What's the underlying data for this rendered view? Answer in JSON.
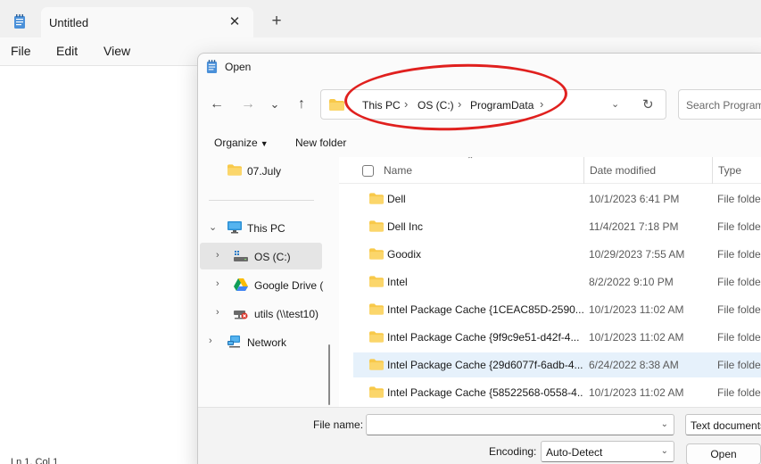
{
  "notepad": {
    "tab_title": "Untitled",
    "tab_close": "✕",
    "new_tab": "+",
    "menus": [
      "File",
      "Edit",
      "View"
    ],
    "status": "Ln 1, Col 1"
  },
  "dialog": {
    "title": "Open",
    "nav": {
      "back": "←",
      "forward": "→",
      "recent": "⌄",
      "up": "↑"
    },
    "breadcrumbs": [
      "This PC",
      "OS (C:)",
      "ProgramData"
    ],
    "crumb_sep": "›",
    "search_placeholder": "Search ProgramData",
    "commands": {
      "organize": "Organize",
      "new_folder": "New folder"
    },
    "tree": [
      {
        "label": "07.July",
        "icon": "folder-icon"
      },
      {
        "label": "This PC",
        "icon": "monitor-icon"
      },
      {
        "label": "OS (C:)",
        "icon": "drive-icon"
      },
      {
        "label": "Google Drive (",
        "icon": "google-drive-icon"
      },
      {
        "label": "utils (\\\\test10)",
        "icon": "network-drive-icon"
      },
      {
        "label": "Network",
        "icon": "network-icon"
      }
    ],
    "columns": {
      "name": "Name",
      "date": "Date modified",
      "type": "Type"
    },
    "files": [
      {
        "name": "Dell",
        "date": "10/1/2023 6:41 PM",
        "type": "File folder"
      },
      {
        "name": "Dell Inc",
        "date": "11/4/2021 7:18 PM",
        "type": "File folder"
      },
      {
        "name": "Goodix",
        "date": "10/29/2023 7:55 AM",
        "type": "File folder"
      },
      {
        "name": "Intel",
        "date": "8/2/2022 9:10 PM",
        "type": "File folder"
      },
      {
        "name": "Intel Package Cache {1CEAC85D-2590...",
        "date": "10/1/2023 11:02 AM",
        "type": "File folder"
      },
      {
        "name": "Intel Package Cache {9f9c9e51-d42f-4...",
        "date": "10/1/2023 11:02 AM",
        "type": "File folder"
      },
      {
        "name": "Intel Package Cache {29d6077f-6adb-4...",
        "date": "6/24/2022 8:38 AM",
        "type": "File folder"
      },
      {
        "name": "Intel Package Cache {58522568-0558-4...",
        "date": "10/1/2023 11:02 AM",
        "type": "File folder"
      }
    ],
    "footer": {
      "filename_label": "File name:",
      "filename_value": "",
      "filetype_value": "Text documents",
      "encoding_label": "Encoding:",
      "encoding_value": "Auto-Detect",
      "open_label": "Open"
    }
  },
  "colors": {
    "folder": "#f8c94a",
    "accent": "#0067c0",
    "annotation": "#e0201e",
    "selection": "#e6f1fb"
  }
}
